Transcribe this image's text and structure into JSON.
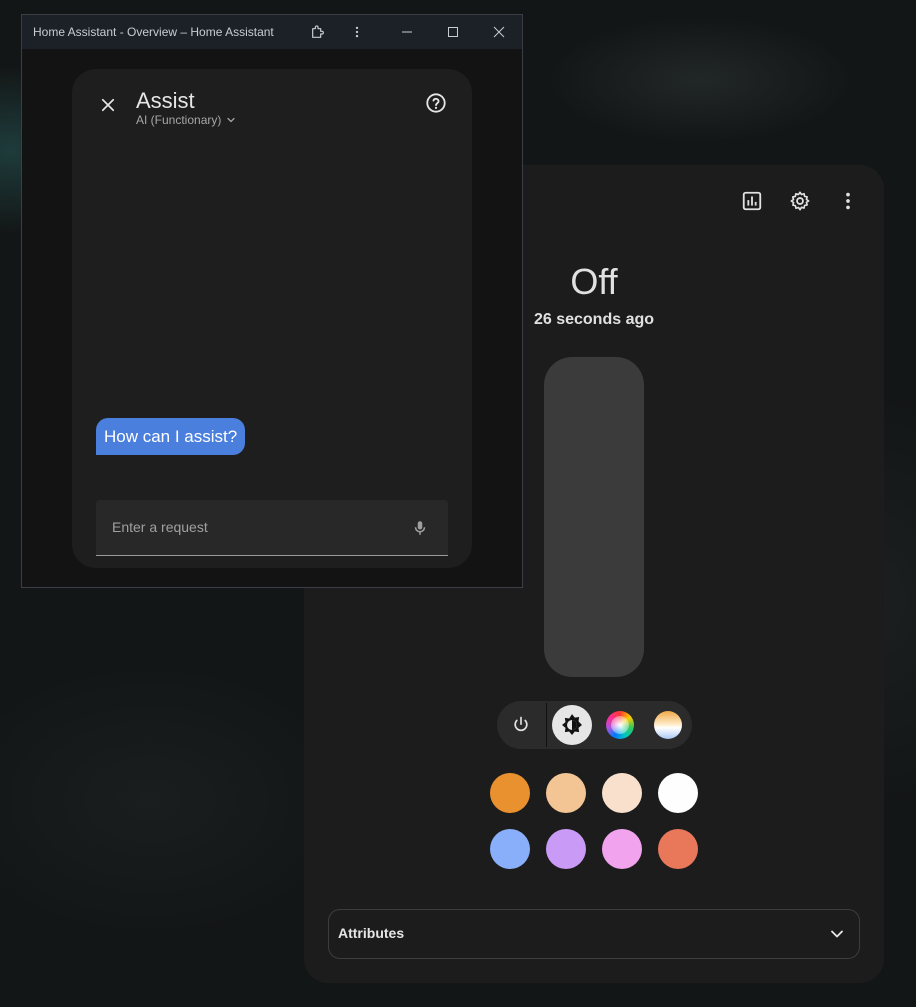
{
  "window": {
    "title": "Home Assistant - Overview – Home Assistant",
    "icons": [
      "extension-icon",
      "more-vert-icon",
      "minimize-icon",
      "maximize-icon",
      "close-icon"
    ]
  },
  "assist": {
    "title": "Assist",
    "pipeline": "AI (Functionary)",
    "greeting": "How can I assist?",
    "input": {
      "placeholder": "Enter a request",
      "value": ""
    }
  },
  "entity": {
    "state": "Off",
    "last_changed": "26 seconds ago",
    "header_icons": [
      "history-chart-icon",
      "settings-gear-icon",
      "more-vert-icon"
    ],
    "modes": [
      "power-icon",
      "brightness-icon",
      "color-wheel-icon",
      "color-temperature-icon"
    ],
    "selected_mode": "brightness",
    "favorite_colors": [
      "#ea912f",
      "#f3c595",
      "#f8e0cd",
      "#fefefe",
      "#89aefa",
      "#c99af6",
      "#f1a3ee",
      "#e9775a"
    ],
    "attributes_label": "Attributes"
  },
  "colors": {
    "accent": "#4a7fde",
    "dialog_bg": "#1c1c1c"
  }
}
